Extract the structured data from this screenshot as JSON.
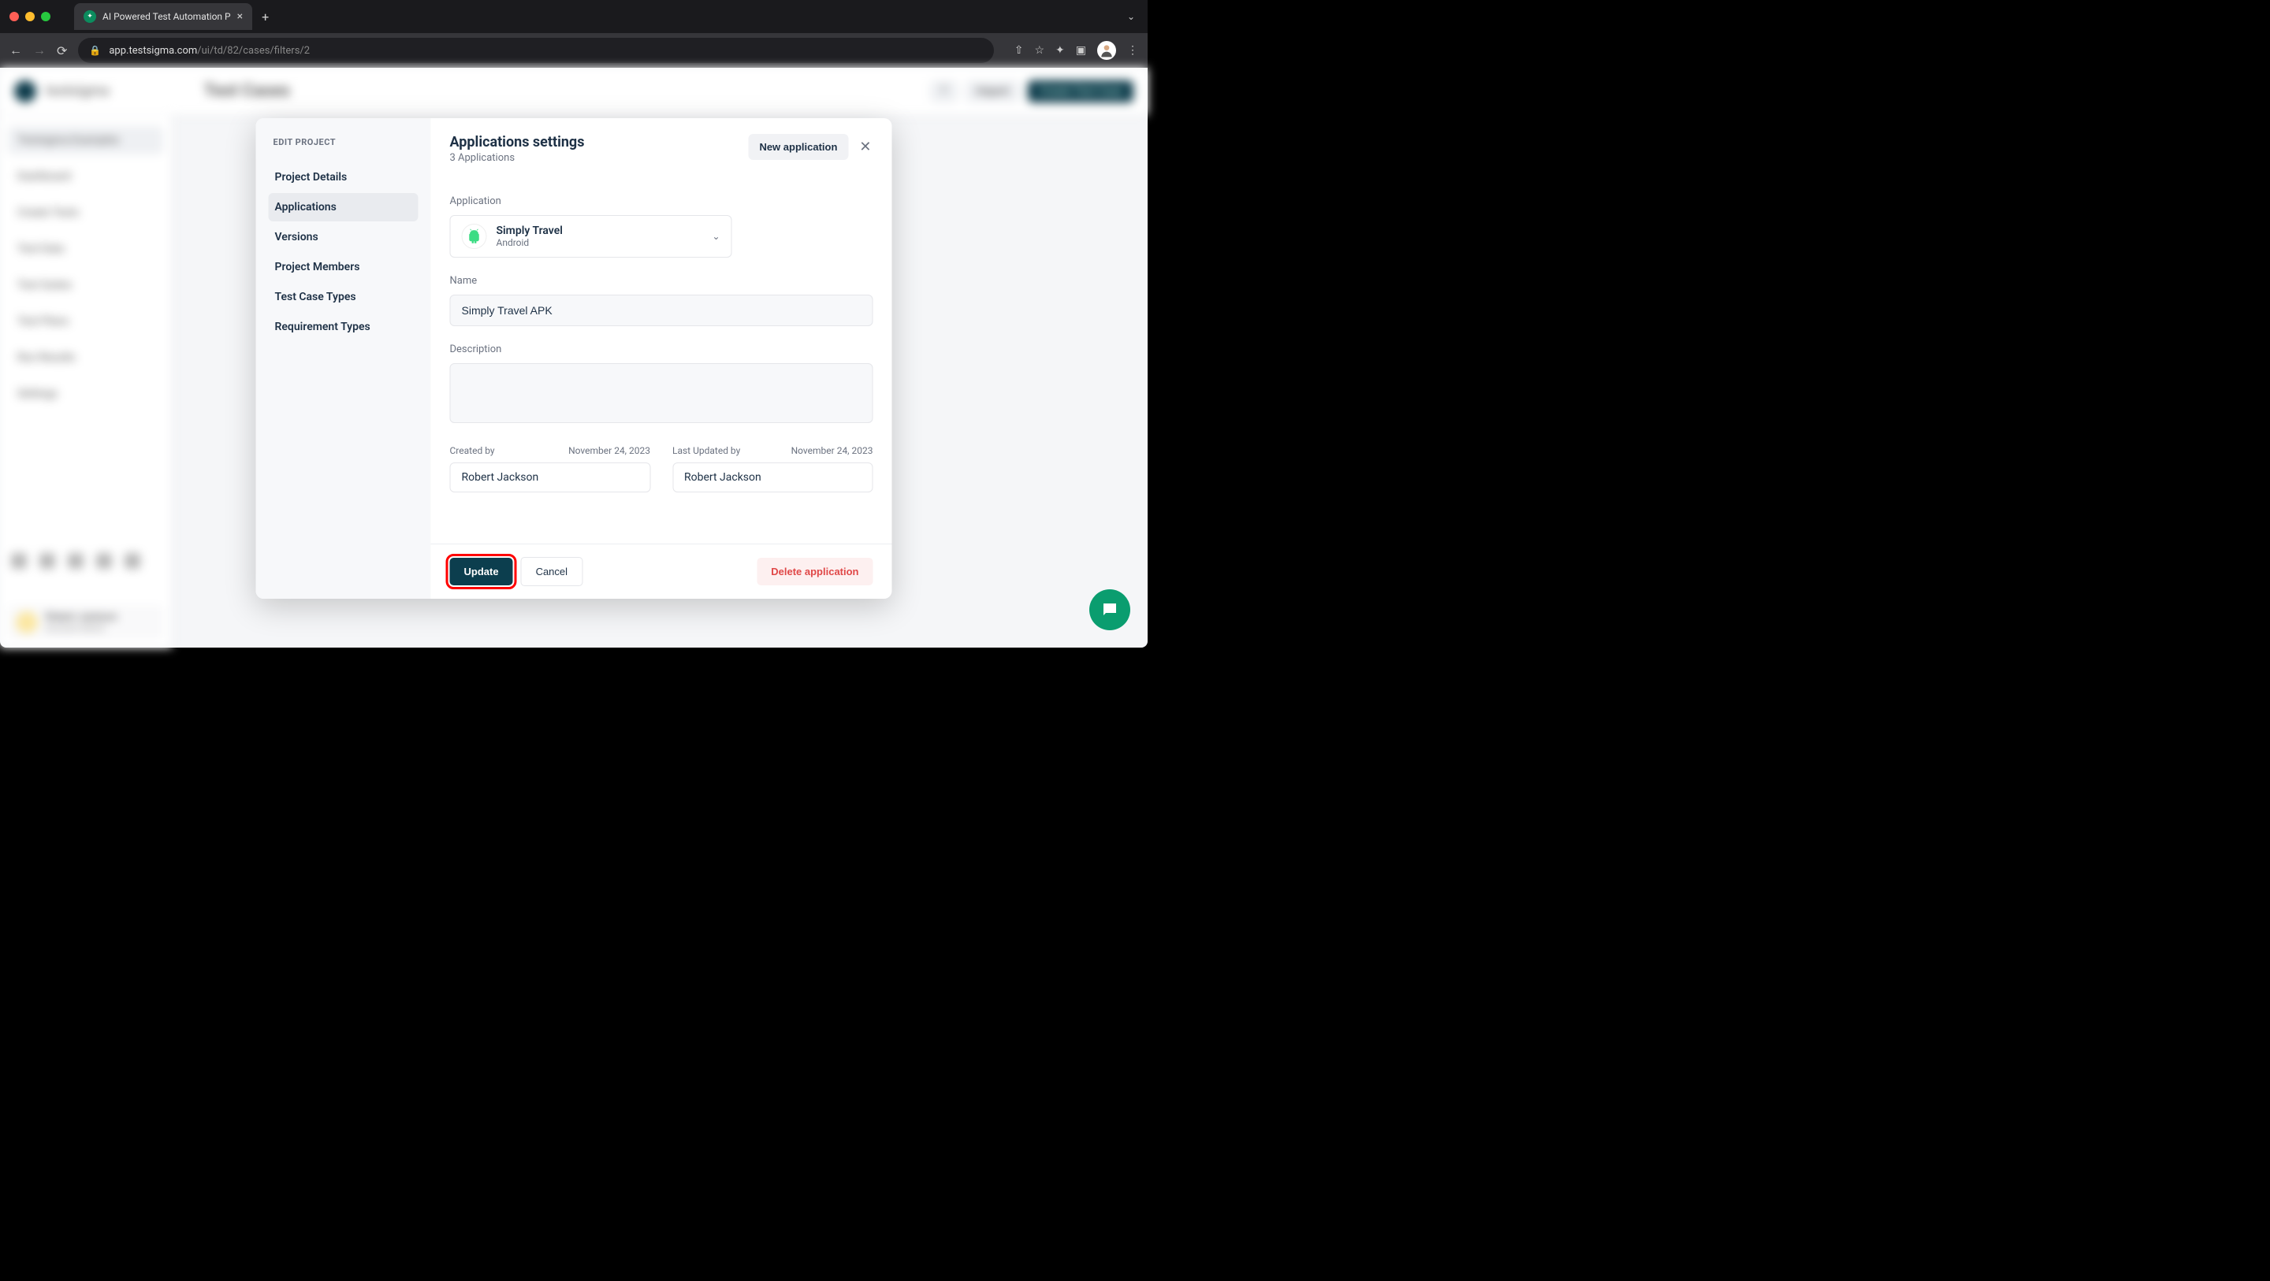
{
  "browser": {
    "tab_title": "AI Powered Test Automation P",
    "url_host": "app.testsigma.com",
    "url_path": "/ui/td/82/cases/filters/2"
  },
  "background": {
    "brand": "testsigma",
    "page_title": "Test Cases",
    "btn_import": "Import",
    "btn_create": "Create Test Case",
    "sidebar_top": "Testsigma Examples",
    "nav": [
      "Dashboard",
      "Create Tests",
      "Test Data",
      "Test Suites",
      "Test Plans",
      "Run Results",
      "Settings"
    ],
    "footer_name": "Robert Jackson",
    "footer_role": "Account Admin"
  },
  "modal": {
    "edit_label": "EDIT PROJECT",
    "sidebar": {
      "items": [
        {
          "label": "Project Details",
          "active": false
        },
        {
          "label": "Applications",
          "active": true
        },
        {
          "label": "Versions",
          "active": false
        },
        {
          "label": "Project Members",
          "active": false
        },
        {
          "label": "Test Case Types",
          "active": false
        },
        {
          "label": "Requirement Types",
          "active": false
        }
      ]
    },
    "header": {
      "title": "Applications settings",
      "subtitle": "3 Applications",
      "new_app": "New application"
    },
    "form": {
      "application_label": "Application",
      "app_name": "Simply Travel",
      "app_platform": "Android",
      "name_label": "Name",
      "name_value": "Simply Travel APK",
      "desc_label": "Description",
      "desc_value": "",
      "created_by_label": "Created by",
      "created_date": "November 24, 2023",
      "created_by_value": "Robert Jackson",
      "updated_by_label": "Last Updated by",
      "updated_date": "November 24, 2023",
      "updated_by_value": "Robert Jackson"
    },
    "footer": {
      "update": "Update",
      "cancel": "Cancel",
      "delete": "Delete application"
    }
  }
}
